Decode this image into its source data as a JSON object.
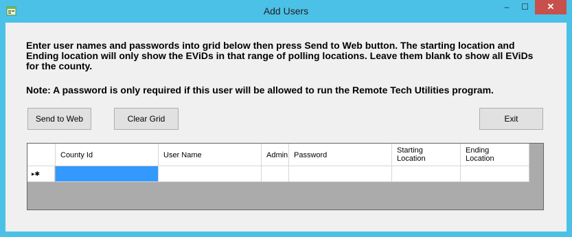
{
  "window": {
    "title": "Add Users",
    "minimize_glyph": "–",
    "maximize_glyph": "☐",
    "close_glyph": "✕",
    "app_icon": "app-window-icon"
  },
  "instructions": "Enter user names and passwords into grid below then press Send to Web button.  The starting location and Ending location will only show the EViDs in that range of polling locations.  Leave them blank to show all EViDs for the county.",
  "note": "Note: A password is only required if this user will be allowed to run the Remote Tech Utilities program.",
  "buttons": {
    "send": "Send to Web",
    "clear": "Clear Grid",
    "exit": "Exit"
  },
  "grid": {
    "columns": [
      {
        "label": "County Id"
      },
      {
        "label": "User Name"
      },
      {
        "label": "Admin"
      },
      {
        "label": "Password"
      },
      {
        "line1": "Starting",
        "line2": "Location"
      },
      {
        "line1": "Ending",
        "line2": "Location"
      }
    ],
    "new_row_indicator": "▸✱"
  },
  "colors": {
    "titlebar": "#4cc1e8",
    "close": "#c7504c",
    "selection": "#3399ff",
    "grid_background": "#ababab"
  }
}
